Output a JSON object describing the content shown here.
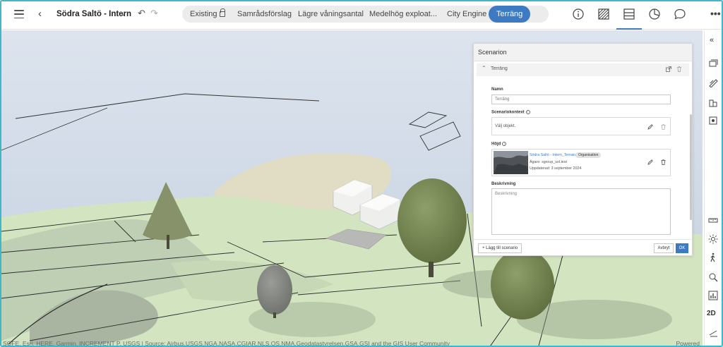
{
  "header": {
    "project_title": "Södra Saltö - Intern",
    "tabs": [
      {
        "label": "Existing",
        "locked": true,
        "active": false
      },
      {
        "label": "Samrådsförslag",
        "active": false
      },
      {
        "label": "Lägre våningsantal",
        "active": false
      },
      {
        "label": "Medelhög exploat...",
        "active": false
      },
      {
        "label": "City Engine",
        "active": false
      },
      {
        "label": "Terräng",
        "active": true
      }
    ],
    "more_label": "•••",
    "right_icons": [
      "info-icon",
      "hatch-pattern-icon",
      "layers-list-icon",
      "pie-chart-icon",
      "comment-icon"
    ],
    "accent_color": "#3d7ac1"
  },
  "map": {
    "attribution": "SOFE, Esri, HERE, Garmin, INCREMENT P, USGS | Source: Airbus,USGS,NGA,NASA,CGIAR,NLS,OS,NMA,Geodatastyrelsen,GSA,GSI and the GIS User Community",
    "powered": "Powered"
  },
  "right_toolbar": {
    "collapse_label": "«",
    "twod_label": "2D",
    "icons": [
      "collapse-icon",
      "map-layers-icon",
      "sketch-icon",
      "buildings-icon",
      "analysis-icon",
      "measure-icon",
      "sun-icon",
      "walk-icon",
      "search-place-icon",
      "chart-icon",
      "2d-toggle",
      "slice-icon"
    ]
  },
  "scenario_panel": {
    "title": "Scenarion",
    "section_title": "Terräng",
    "name_label": "Namn",
    "name_value": "Terräng",
    "context_label": "Scenariokontext",
    "context_value": "Välj objekt.",
    "height_label": "Höjd",
    "height_item": {
      "name": "Södra Saltö - Intern_Terrain",
      "badge": "Organisation",
      "owner": "Ägare: sgroup_sol.test",
      "updated": "Uppdaterad: 3 september 2024"
    },
    "description_label": "Beskrivning",
    "description_placeholder": "Beskrivning",
    "add_button": "Lägg till scenario",
    "cancel_button": "Avbryt",
    "ok_button": "OK"
  }
}
